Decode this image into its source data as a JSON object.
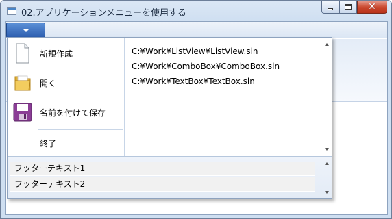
{
  "window": {
    "title": "02.アプリケーションメニューを使用する",
    "minimize_icon": "minimize-icon",
    "maximize_icon": "maximize-icon",
    "close_icon": "close-icon",
    "close_glyph": "✕"
  },
  "app_menu": {
    "button_icon": "dropdown-arrow-icon",
    "items": [
      {
        "label": "新規作成",
        "icon": "new-document-icon"
      },
      {
        "label": "開く",
        "icon": "folder-icon"
      },
      {
        "label": "名前を付けて保存",
        "icon": "floppy-disk-icon"
      },
      {
        "label": "終了",
        "icon": ""
      }
    ],
    "recent_files": [
      "C:¥Work¥ListView¥ListView.sln",
      "C:¥Work¥ComboBox¥ComboBox.sln",
      "C:¥Work¥TextBox¥TextBox.sln"
    ],
    "footer_items": [
      "フッターテキスト1",
      "フッターテキスト2"
    ]
  },
  "colors": {
    "accent": "#2e5fb0",
    "close_button": "#c9462c",
    "folder": "#f0c04a",
    "floppy": "#8b3d96"
  }
}
